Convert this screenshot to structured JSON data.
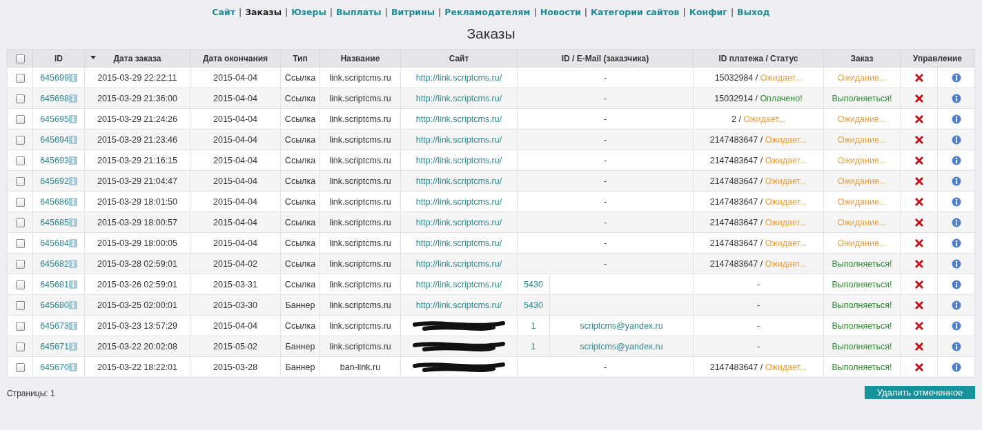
{
  "nav": [
    {
      "label": "Сайт",
      "selected": false
    },
    {
      "separator": "|",
      "label": "Заказы",
      "selected": true
    },
    {
      "separator": "|",
      "label": "Юзеры",
      "selected": false
    },
    {
      "separator": "|",
      "label": "Выплаты",
      "selected": false
    },
    {
      "separator": "|",
      "label": "Витрины",
      "selected": false
    },
    {
      "separator": "|",
      "label": "Рекламодателям",
      "selected": false
    },
    {
      "separator": "|",
      "label": "Новости",
      "selected": false
    },
    {
      "separator": "|",
      "label": "Категории сайтов",
      "selected": false
    },
    {
      "separator": "|",
      "label": "Конфиг",
      "selected": false
    },
    {
      "separator": "|",
      "label": "Выход",
      "selected": false
    }
  ],
  "title": "Заказы",
  "table": {
    "select_all": {
      "checked": false
    },
    "columns": [
      {
        "label": "ID",
        "sorted": false
      },
      {
        "label": "Дата заказа",
        "sorted": true
      },
      {
        "label": "Дата окончания",
        "sorted": false
      },
      {
        "label": "Тип",
        "sorted": false
      },
      {
        "label": "Название",
        "sorted": false
      },
      {
        "label": "Сайт",
        "sorted": false
      },
      {
        "label": "ID / E-Mail (заказчика)",
        "sorted": false
      },
      {
        "label": "ID платежа / Статус",
        "sorted": false
      },
      {
        "label": "Заказ",
        "sorted": false
      },
      {
        "label": "Управление",
        "sorted": false
      }
    ],
    "rows": [
      {
        "checked": false,
        "id": "645699",
        "date": "2015-03-29 22:22:11",
        "end": "2015-04-04",
        "type": "Ссылка",
        "name": "link.scriptcms.ru",
        "site": "http://link.scriptcms.ru/",
        "redacted": false,
        "customer": {
          "kind": "none",
          "text": "-"
        },
        "payment": {
          "kind": "status",
          "id": "15032984",
          "separator": "/",
          "status": "Ожидает...",
          "paid": false
        },
        "order": {
          "text": "Ожидание...",
          "running": false
        }
      },
      {
        "checked": false,
        "id": "645698",
        "date": "2015-03-29 21:36:00",
        "end": "2015-04-04",
        "type": "Ссылка",
        "name": "link.scriptcms.ru",
        "site": "http://link.scriptcms.ru/",
        "redacted": false,
        "customer": {
          "kind": "none",
          "text": "-"
        },
        "payment": {
          "kind": "status",
          "id": "15032914",
          "separator": "/",
          "status": "Оплачено!",
          "paid": true
        },
        "order": {
          "text": "Выполняеться!",
          "running": true
        }
      },
      {
        "checked": false,
        "id": "645695",
        "date": "2015-03-29 21:24:26",
        "end": "2015-04-04",
        "type": "Ссылка",
        "name": "link.scriptcms.ru",
        "site": "http://link.scriptcms.ru/",
        "redacted": false,
        "customer": {
          "kind": "none",
          "text": "-"
        },
        "payment": {
          "kind": "status",
          "id": "2",
          "separator": "/",
          "status": "Ожидает...",
          "paid": false
        },
        "order": {
          "text": "Ожидание...",
          "running": false
        }
      },
      {
        "checked": false,
        "id": "645694",
        "date": "2015-03-29 21:23:46",
        "end": "2015-04-04",
        "type": "Ссылка",
        "name": "link.scriptcms.ru",
        "site": "http://link.scriptcms.ru/",
        "redacted": false,
        "customer": {
          "kind": "none",
          "text": "-"
        },
        "payment": {
          "kind": "status",
          "id": "2147483647",
          "separator": "/",
          "status": "Ожидает...",
          "paid": false
        },
        "order": {
          "text": "Ожидание...",
          "running": false
        }
      },
      {
        "checked": false,
        "id": "645693",
        "date": "2015-03-29 21:16:15",
        "end": "2015-04-04",
        "type": "Ссылка",
        "name": "link.scriptcms.ru",
        "site": "http://link.scriptcms.ru/",
        "redacted": false,
        "customer": {
          "kind": "none",
          "text": "-"
        },
        "payment": {
          "kind": "status",
          "id": "2147483647",
          "separator": "/",
          "status": "Ожидает...",
          "paid": false
        },
        "order": {
          "text": "Ожидание...",
          "running": false
        }
      },
      {
        "checked": false,
        "id": "645692",
        "date": "2015-03-29 21:04:47",
        "end": "2015-04-04",
        "type": "Ссылка",
        "name": "link.scriptcms.ru",
        "site": "http://link.scriptcms.ru/",
        "redacted": false,
        "customer": {
          "kind": "none",
          "text": "-"
        },
        "payment": {
          "kind": "status",
          "id": "2147483647",
          "separator": "/",
          "status": "Ожидает...",
          "paid": false
        },
        "order": {
          "text": "Ожидание...",
          "running": false
        }
      },
      {
        "checked": false,
        "id": "645686",
        "date": "2015-03-29 18:01:50",
        "end": "2015-04-04",
        "type": "Ссылка",
        "name": "link.scriptcms.ru",
        "site": "http://link.scriptcms.ru/",
        "redacted": false,
        "customer": {
          "kind": "none",
          "text": "-"
        },
        "payment": {
          "kind": "status",
          "id": "2147483647",
          "separator": "/",
          "status": "Ожидает...",
          "paid": false
        },
        "order": {
          "text": "Ожидание...",
          "running": false
        }
      },
      {
        "checked": false,
        "id": "645685",
        "date": "2015-03-29 18:00:57",
        "end": "2015-04-04",
        "type": "Ссылка",
        "name": "link.scriptcms.ru",
        "site": "http://link.scriptcms.ru/",
        "redacted": false,
        "customer": {
          "kind": "none",
          "text": "-"
        },
        "payment": {
          "kind": "status",
          "id": "2147483647",
          "separator": "/",
          "status": "Ожидает...",
          "paid": false
        },
        "order": {
          "text": "Ожидание...",
          "running": false
        }
      },
      {
        "checked": false,
        "id": "645684",
        "date": "2015-03-29 18:00:05",
        "end": "2015-04-04",
        "type": "Ссылка",
        "name": "link.scriptcms.ru",
        "site": "http://link.scriptcms.ru/",
        "redacted": false,
        "customer": {
          "kind": "none",
          "text": "-"
        },
        "payment": {
          "kind": "status",
          "id": "2147483647",
          "separator": "/",
          "status": "Ожидает...",
          "paid": false
        },
        "order": {
          "text": "Ожидание...",
          "running": false
        }
      },
      {
        "checked": false,
        "id": "645682",
        "date": "2015-03-28 02:59:01",
        "end": "2015-04-02",
        "type": "Ссылка",
        "name": "link.scriptcms.ru",
        "site": "http://link.scriptcms.ru/",
        "redacted": false,
        "customer": {
          "kind": "none",
          "text": "-"
        },
        "payment": {
          "kind": "status",
          "id": "2147483647",
          "separator": "/",
          "status": "Ожидает...",
          "paid": false
        },
        "order": {
          "text": "Выполняеться!",
          "running": true
        }
      },
      {
        "checked": false,
        "id": "645681",
        "date": "2015-03-26 02:59:01",
        "end": "2015-03-31",
        "type": "Ссылка",
        "name": "link.scriptcms.ru",
        "site": "http://link.scriptcms.ru/",
        "redacted": false,
        "customer": {
          "kind": "user",
          "id": "5430"
        },
        "payment": {
          "kind": "none",
          "text": "-"
        },
        "order": {
          "text": "Выполняеться!",
          "running": true
        }
      },
      {
        "checked": false,
        "id": "645680",
        "date": "2015-03-25 02:00:01",
        "end": "2015-03-30",
        "type": "Баннер",
        "name": "link.scriptcms.ru",
        "site": "http://link.scriptcms.ru/",
        "redacted": false,
        "customer": {
          "kind": "user",
          "id": "5430"
        },
        "payment": {
          "kind": "none",
          "text": "-"
        },
        "order": {
          "text": "Выполняеться!",
          "running": true
        }
      },
      {
        "checked": false,
        "id": "645673",
        "date": "2015-03-23 13:57:29",
        "end": "2015-04-04",
        "type": "Ссылка",
        "name": "link.scriptcms.ru",
        "redacted": true,
        "customer": {
          "kind": "user",
          "id": "1",
          "email": "scriptcms@yandex.ru"
        },
        "payment": {
          "kind": "none",
          "text": "-"
        },
        "order": {
          "text": "Выполняеться!",
          "running": true
        }
      },
      {
        "checked": false,
        "id": "645671",
        "date": "2015-03-22 20:02:08",
        "end": "2015-05-02",
        "type": "Баннер",
        "name": "link.scriptcms.ru",
        "redacted": true,
        "customer": {
          "kind": "user",
          "id": "1",
          "email": "scriptcms@yandex.ru"
        },
        "payment": {
          "kind": "none",
          "text": "-"
        },
        "order": {
          "text": "Выполняеться!",
          "running": true
        }
      },
      {
        "checked": false,
        "id": "645670",
        "date": "2015-03-22 18:22:01",
        "end": "2015-03-28",
        "type": "Баннер",
        "name": "ban-link.ru",
        "redacted": true,
        "customer": {
          "kind": "none",
          "text": "-"
        },
        "payment": {
          "kind": "status",
          "id": "2147483647",
          "separator": "/",
          "status": "Ожидает...",
          "paid": false
        },
        "order": {
          "text": "Выполняеться!",
          "running": true
        }
      }
    ]
  },
  "pages": "Страницы: 1",
  "delete_button": "Удалить отмеченное"
}
